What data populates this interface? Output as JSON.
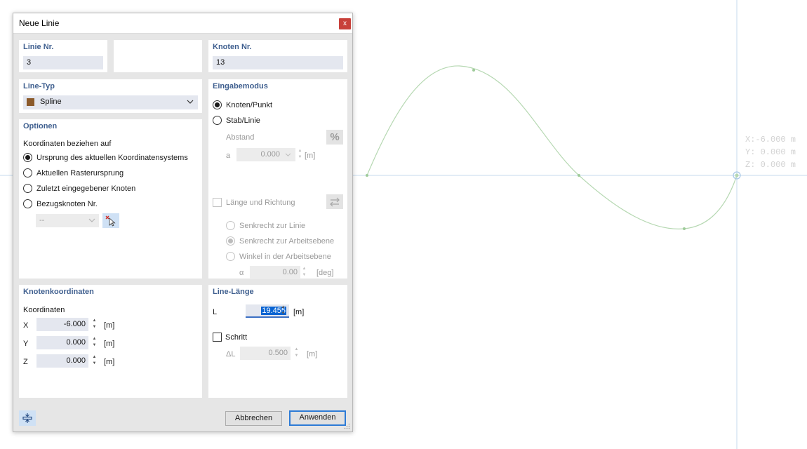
{
  "window": {
    "title": "Neue Linie",
    "close_glyph": "x"
  },
  "line_no": {
    "label": "Linie Nr.",
    "value": "3"
  },
  "node_no": {
    "label": "Knoten Nr.",
    "value": "13"
  },
  "line_type": {
    "label": "Line-Typ",
    "selected": "Spline",
    "swatch_color": "#8b5a2b"
  },
  "options": {
    "title": "Optionen",
    "subtitle": "Koordinaten beziehen auf",
    "radios": [
      {
        "label": "Ursprung des aktuellen Koordinatensystems",
        "checked": true
      },
      {
        "label": "Aktuellen Rasterursprung",
        "checked": false
      },
      {
        "label": "Zuletzt eingegebener Knoten",
        "checked": false
      },
      {
        "label": "Bezugsknoten Nr.",
        "checked": false
      }
    ],
    "ref_node_value": "--"
  },
  "input_mode": {
    "title": "Eingabemodus",
    "radio_node": "Knoten/Punkt",
    "radio_member": "Stab/Linie",
    "distance_label": "Abstand",
    "a_label": "a",
    "a_value": "0.000",
    "a_unit": "[m]",
    "length_dir_label": "Länge und Richtung",
    "sub_radios": [
      {
        "label": "Senkrecht zur Linie",
        "checked": false
      },
      {
        "label": "Senkrecht zur Arbeitsebene",
        "checked": true
      },
      {
        "label": "Winkel in der Arbeitsebene",
        "checked": false
      }
    ],
    "alpha_label": "α",
    "alpha_value": "0.00",
    "alpha_unit": "[deg]"
  },
  "node_coords": {
    "title": "Knotenkoordinaten",
    "subtitle": "Koordinaten",
    "rows": [
      {
        "axis": "X",
        "value": "-6.000",
        "unit": "[m]"
      },
      {
        "axis": "Y",
        "value": "0.000",
        "unit": "[m]"
      },
      {
        "axis": "Z",
        "value": "0.000",
        "unit": "[m]"
      }
    ]
  },
  "line_length": {
    "title": "Line-Länge",
    "l_label": "L",
    "l_value": "19.455",
    "l_unit": "[m]",
    "step_label": "Schritt",
    "dl_label": "ΔL",
    "dl_value": "0.500",
    "dl_unit": "[m]"
  },
  "buttons": {
    "cancel": "Abbrechen",
    "apply": "Anwenden"
  },
  "canvas": {
    "readout_x": "X:-6.000 m",
    "readout_y": "Y: 0.000 m",
    "readout_z": "Z: 0.000 m",
    "spline_color": "#b6d8b2",
    "axis_color": "#c6daee"
  }
}
